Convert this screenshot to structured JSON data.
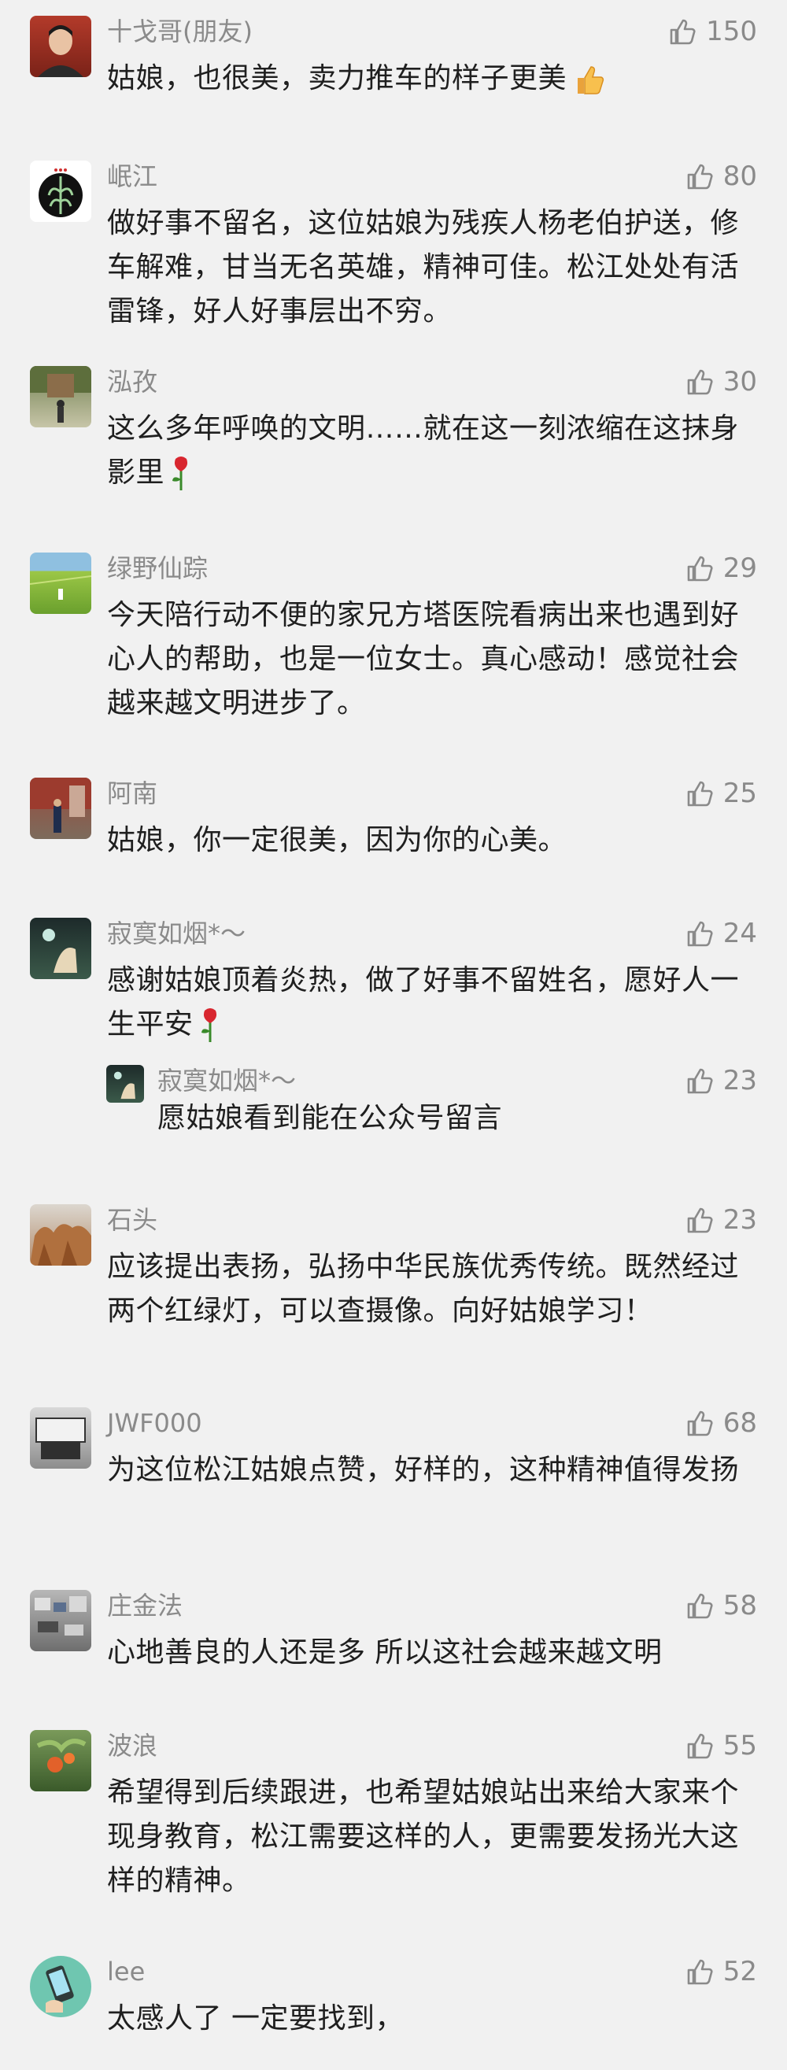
{
  "comments": [
    {
      "name": "十戈哥(朋友)",
      "likes": "150",
      "text": "姑娘，也很美，卖力推车的样子更美",
      "emoji": "thumbs-up-emoji"
    },
    {
      "name": "岷江",
      "likes": "80",
      "text": "做好事不留名，这位姑娘为残疾人杨老伯护送，修车解难，甘当无名英雄，精神可佳。松江处处有活雷锋，好人好事层出不穷。"
    },
    {
      "name": "泓孜",
      "likes": "30",
      "text": "这么多年呼唤的文明……就在这一刻浓缩在这抹身影里",
      "emoji": "rose-emoji"
    },
    {
      "name": "绿野仙踪",
      "likes": "29",
      "text": "今天陪行动不便的家兄方塔医院看病出来也遇到好心人的帮助，也是一位女士。真心感动！感觉社会越来越文明进步了。"
    },
    {
      "name": "阿南",
      "likes": "25",
      "text": "姑娘，你一定很美，因为你的心美。"
    },
    {
      "name": "寂寞如烟*～",
      "likes": "24",
      "text": "感谢姑娘顶着炎热，做了好事不留姓名，愿好人一生平安",
      "emoji": "rose-emoji"
    },
    {
      "name": "石头",
      "likes": "23",
      "text": "应该提出表扬，弘扬中华民族优秀传统。既然经过两个红绿灯，可以查摄像。向好姑娘学习！"
    },
    {
      "name": "JWF000",
      "likes": "68",
      "text": "为这位松江姑娘点赞，好样的，这种精神值得发扬"
    },
    {
      "name": "庄金法",
      "likes": "58",
      "text": "心地善良的人还是多 所以这社会越来越文明"
    },
    {
      "name": "波浪",
      "likes": "55",
      "text": "希望得到后续跟进，也希望姑娘站出来给大家来个现身教育，松江需要这样的人，更需要发扬光大这样的精神。"
    },
    {
      "name": "lee",
      "likes": "52",
      "text": "太感人了 一定要找到，"
    }
  ],
  "reply": {
    "name": "寂寞如烟*～",
    "likes": "23",
    "text": "愿姑娘看到能在公众号留言"
  }
}
